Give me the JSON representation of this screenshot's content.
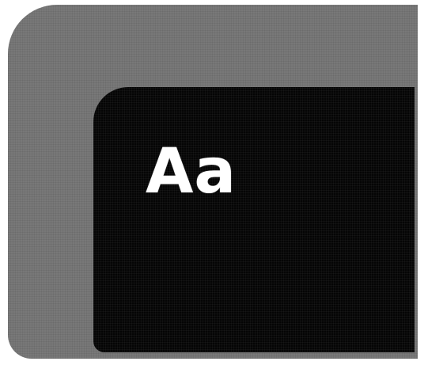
{
  "preview": {
    "sample_text": "Aa"
  },
  "colors": {
    "outer_panel": "#787878",
    "inner_panel": "#050505",
    "text": "#ffffff",
    "page_background": "#ffffff"
  }
}
